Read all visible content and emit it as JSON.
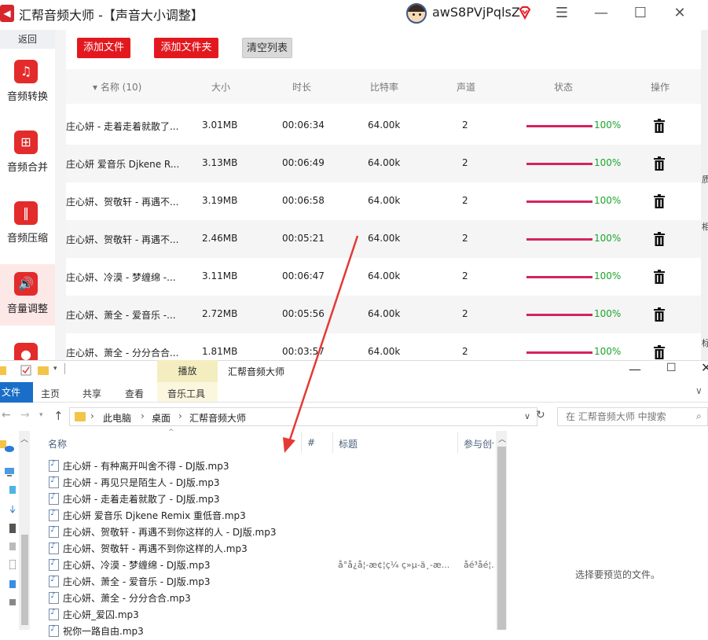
{
  "app": {
    "logo_glyph": "◀",
    "title": "汇帮音频大师  -【声音大小调整】",
    "username": "awS8PVjPqlsZ",
    "vip_icon": "diamond-icon",
    "menu_glyph": "☰",
    "min_glyph": "—",
    "max_glyph": "☐",
    "close_glyph": "✕"
  },
  "sidebar": {
    "back_label": "返回",
    "items": [
      {
        "label": "音频转换",
        "icon": "audio-convert-icon",
        "glyph": "♫"
      },
      {
        "label": "音频合并",
        "icon": "audio-merge-icon",
        "glyph": "⊞"
      },
      {
        "label": "音频压缩",
        "icon": "audio-compress-icon",
        "glyph": "‖"
      },
      {
        "label": "音量调整",
        "icon": "volume-icon",
        "glyph": "🔊",
        "active": true
      },
      {
        "label": "",
        "icon": "record-icon",
        "glyph": "●"
      }
    ]
  },
  "toolbar": {
    "add_file": "添加文件",
    "add_folder": "添加文件夹",
    "clear_list": "清空列表"
  },
  "table": {
    "headers": {
      "name": "▾ 名称 (10)",
      "size": "大小",
      "duration": "时长",
      "bitrate": "比特率",
      "channels": "声道",
      "status": "状态",
      "action": "操作"
    },
    "rows": [
      {
        "name": "庄心妍 - 走着走着就散了...",
        "size": "3.01MB",
        "duration": "00:06:34",
        "bitrate": "64.00k",
        "channels": "2",
        "progress": 1.0,
        "status": "100%"
      },
      {
        "name": "庄心妍 爱音乐 Djkene R...",
        "size": "3.13MB",
        "duration": "00:06:49",
        "bitrate": "64.00k",
        "channels": "2",
        "progress": 1.0,
        "status": "100%"
      },
      {
        "name": "庄心妍、贺敬轩 - 再遇不...",
        "size": "3.19MB",
        "duration": "00:06:58",
        "bitrate": "64.00k",
        "channels": "2",
        "progress": 1.0,
        "status": "100%"
      },
      {
        "name": "庄心妍、贺敬轩 - 再遇不...",
        "size": "2.46MB",
        "duration": "00:05:21",
        "bitrate": "64.00k",
        "channels": "2",
        "progress": 1.0,
        "status": "100%"
      },
      {
        "name": "庄心妍、冷漠 - 梦缠绵 -...",
        "size": "3.11MB",
        "duration": "00:06:47",
        "bitrate": "64.00k",
        "channels": "2",
        "progress": 1.0,
        "status": "100%"
      },
      {
        "name": "庄心妍、萧全 - 爱音乐 -...",
        "size": "2.72MB",
        "duration": "00:05:56",
        "bitrate": "64.00k",
        "channels": "2",
        "progress": 1.0,
        "status": "100%"
      },
      {
        "name": "庄心妍、萧全 - 分分合合...",
        "size": "1.81MB",
        "duration": "00:03:57",
        "bitrate": "64.00k",
        "channels": "2",
        "progress": 1.0,
        "status": "100%"
      }
    ]
  },
  "right_strip": {
    "t1": "质",
    "t2": "相",
    "t3": "标"
  },
  "explorer": {
    "title": "汇帮音频大师",
    "context_tab": "播放",
    "tabs": {
      "file": "文件",
      "home": "主页",
      "share": "共享",
      "view": "查看",
      "music_tools": "音乐工具"
    },
    "min_glyph": "—",
    "max_glyph": "☐",
    "close_glyph": "✕",
    "ribbon_expand": "∨",
    "breadcrumb": [
      "此电脑",
      "桌面",
      "汇帮音频大师"
    ],
    "search_placeholder": "在 汇帮音频大师 中搜索",
    "columns": {
      "name": "名称",
      "number": "#",
      "title": "标题",
      "participating": "参与创作"
    },
    "files": [
      "庄心妍 - 有种离开叫舍不得 - DJ版.mp3",
      "庄心妍 - 再见只是陌生人 - DJ版.mp3",
      "庄心妍 - 走着走着就散了 - DJ版.mp3",
      "庄心妍 爱音乐 Djkene Remix 重低音.mp3",
      "庄心妍、贺敬轩 - 再遇不到你这样的人 - DJ版.mp3",
      "庄心妍、贺敬轩 - 再遇不到你这样的人.mp3",
      "庄心妍、冷漠 - 梦缠绵 - DJ版.mp3",
      "庄心妍、萧全 - 爱音乐 - DJ版.mp3",
      "庄心妍、萧全 - 分分合合.mp3",
      "庄心妍_爱囚.mp3",
      "祝你一路自由.mp3"
    ],
    "garbled_title": "å°å¿å¦-æ¢¦ç¼ ç»µ-ä¸-æ...",
    "garbled_artist": "åé³åé¦...",
    "preview_hint": "选择要预览的文件。"
  }
}
